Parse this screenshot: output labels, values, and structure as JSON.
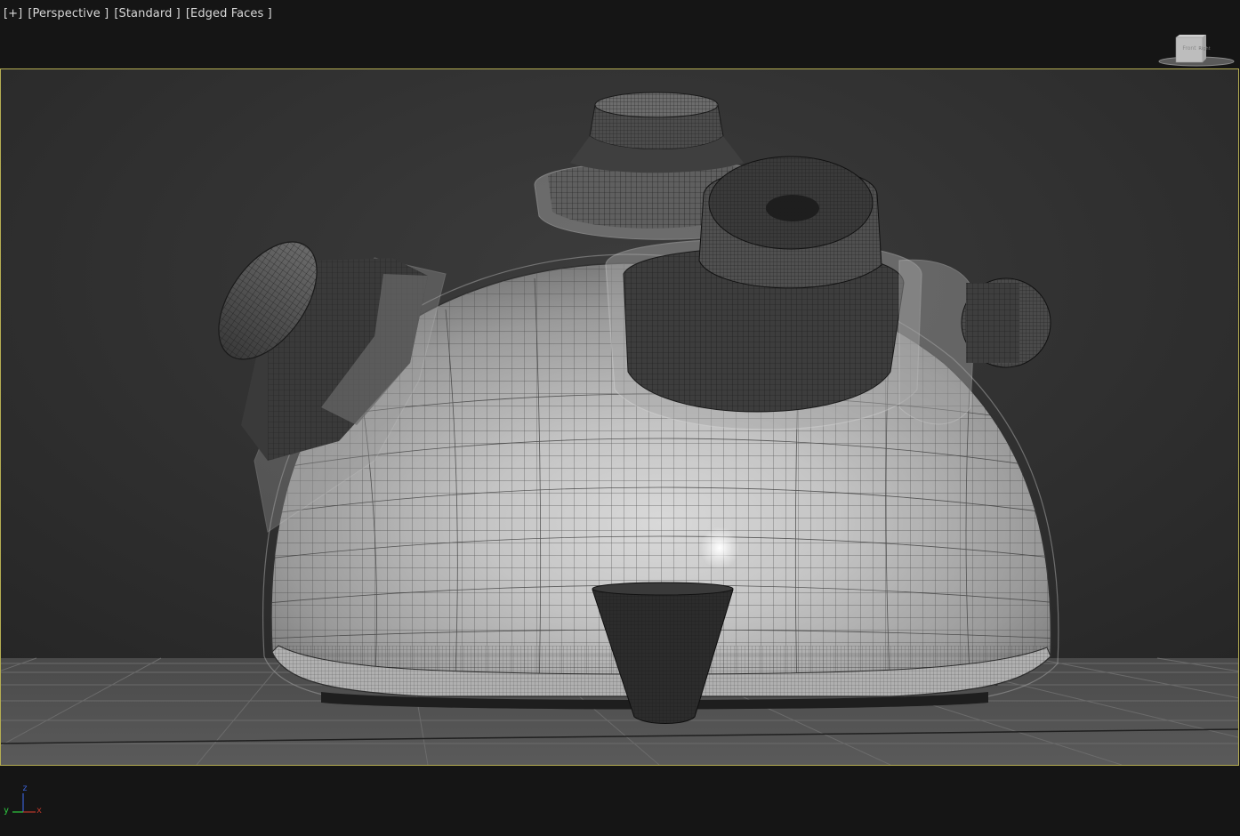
{
  "viewport": {
    "labels": {
      "plus": "[+]",
      "view": "[Perspective ]",
      "shading": "[Standard ]",
      "edged": "[Edged Faces ]"
    },
    "frame_color": "#b5ad52",
    "background_color": "#2b2b2b",
    "letterbox_color": "#151515"
  },
  "viewcube": {
    "icon": "viewcube-icon",
    "front_label": "Front",
    "right_label": "Right"
  },
  "axis_tripod": {
    "icon": "axis-tripod-icon",
    "x": "x",
    "y": "y",
    "z": "z",
    "x_color": "#c0392b",
    "y_color": "#2ecc40",
    "z_color": "#3a5fd0"
  },
  "scene": {
    "object": "wireframe-dome-object",
    "grid": "home-grid"
  }
}
